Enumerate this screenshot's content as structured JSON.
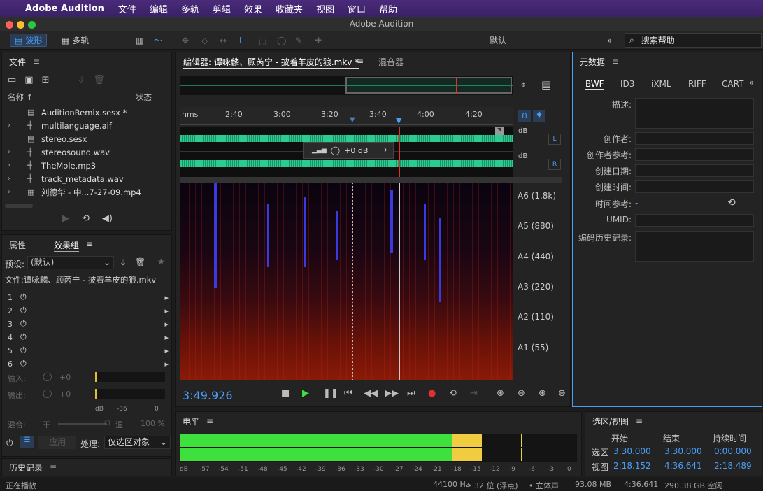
{
  "menubar": {
    "app": "Adobe Audition",
    "items": [
      "文件",
      "编辑",
      "多轨",
      "剪辑",
      "效果",
      "收藏夹",
      "视图",
      "窗口",
      "帮助"
    ]
  },
  "window": {
    "title": "Adobe Audition"
  },
  "toolbar": {
    "waveform": "波形",
    "multitrack": "多轨",
    "workspace": "默认",
    "search_placeholder": "搜索帮助"
  },
  "files": {
    "title": "文件",
    "col_name": "名称 ↑",
    "col_status": "状态",
    "items": [
      "AuditionRemix.sesx *",
      "multilanguage.aif",
      "stereo.sesx",
      "stereosound.wav",
      "TheMole.mp3",
      "track_metadata.wav",
      "刘德华 - 中...7-27-09.mp4"
    ]
  },
  "effects": {
    "tab_props": "属性",
    "tab_rack": "效果组",
    "preset_label": "预设:",
    "preset_value": "(默认)",
    "file_label": "文件:谭咏麟、顾芮宁 - 披着羊皮的狼.mkv",
    "slots": [
      "1",
      "2",
      "3",
      "4",
      "5",
      "6"
    ],
    "input_label": "输入:",
    "input_val": "+0",
    "output_label": "输出:",
    "output_val": "+0",
    "meter_ticks": [
      "dB",
      "-36",
      "0"
    ],
    "mix_label": "混合:",
    "mix_dry": "干",
    "mix_wet": "湿",
    "mix_pct": "100 %",
    "apply": "应用",
    "process_label": "处理:",
    "process_value": "仅选区对象"
  },
  "history": {
    "title": "历史记录"
  },
  "status": {
    "left": "正在播放",
    "rate": "44100 Hz",
    "bits": "32 位 (浮点)",
    "channels": "立体声",
    "size": "93.08 MB",
    "dur": "4:36.641",
    "free": "290.38 GB 空闲"
  },
  "editor": {
    "tab": "编辑器: 谭咏麟、顾芮宁 - 披着羊皮的狼.mkv *",
    "mixer": "混音器",
    "time_unit": "hms",
    "ticks": [
      "2:40",
      "3:00",
      "3:20",
      "3:40",
      "4:00",
      "4:20"
    ],
    "gain": "+0 dB",
    "ch_l": "L",
    "ch_r": "R",
    "db": "dB",
    "notes": [
      "A6 (1.8k)",
      "A5 (880)",
      "A4 (440)",
      "A3 (220)",
      "A2 (110)",
      "A1 (55)"
    ],
    "time": "3:49.926"
  },
  "level": {
    "title": "电平",
    "ticks": [
      "dB",
      "-57",
      "-54",
      "-51",
      "-48",
      "-45",
      "-42",
      "-39",
      "-36",
      "-33",
      "-30",
      "-27",
      "-24",
      "-21",
      "-18",
      "-15",
      "-12",
      "-9",
      "-6",
      "-3",
      "0"
    ],
    "fill_fraction": 0.76,
    "peak_fraction": 0.86
  },
  "selection": {
    "title": "选区/视图",
    "col_start": "开始",
    "col_end": "结束",
    "col_dur": "持续时间",
    "sel_label": "选区",
    "sel_start": "3:30.000",
    "sel_end": "3:30.000",
    "sel_dur": "0:00.000",
    "view_label": "视图",
    "view_start": "2:18.152",
    "view_end": "4:36.641",
    "view_dur": "2:18.489"
  },
  "metadata": {
    "title": "元数据",
    "tabs": [
      "BWF",
      "ID3",
      "iXML",
      "RIFF",
      "CART"
    ],
    "fields": [
      "描述:",
      "创作者:",
      "创作者参考:",
      "创建日期:",
      "创建时间:",
      "时间参考:",
      "UMID:",
      "编码历史记录:"
    ],
    "timeref_val": "-"
  },
  "colors": {
    "accent": "#4a9ff5",
    "wave": "#2fe0a0",
    "meter_green": "#3ee03e",
    "meter_yellow": "#f0cc40",
    "playhead": "#e03030"
  }
}
